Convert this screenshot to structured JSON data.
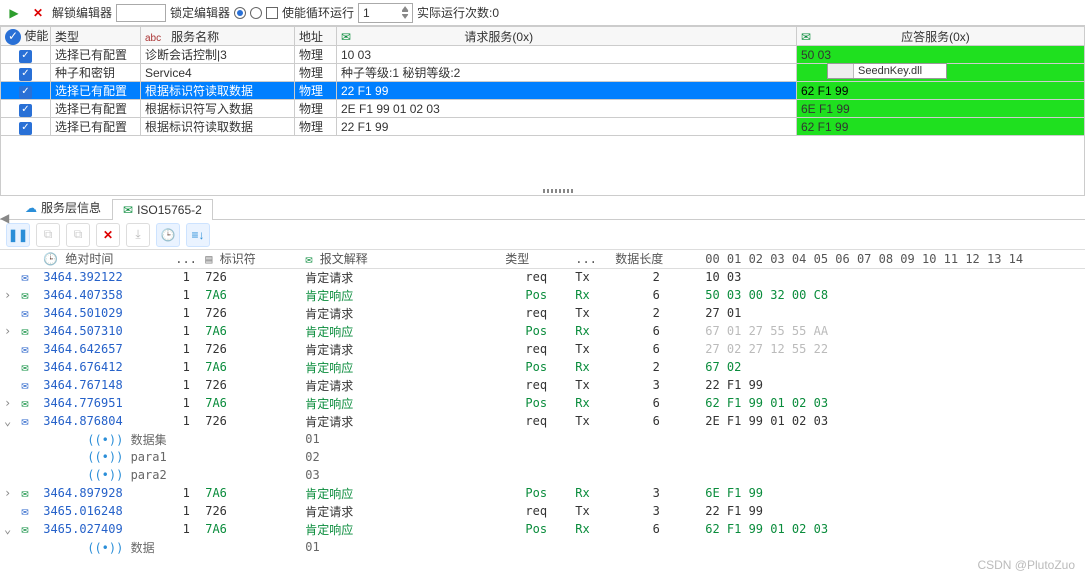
{
  "toolbar": {
    "unlock_label": "解锁编辑器",
    "lock_label": "锁定编辑器",
    "loop_label": "使能循环运行",
    "loop_count": "1",
    "actual_runs_label": "实际运行次数:0"
  },
  "grid": {
    "headers": {
      "enable": "使能",
      "type": "类型",
      "type_hint": "abc",
      "service": "服务名称",
      "addr": "地址",
      "req": "请求服务(0x)",
      "resp": "应答服务(0x)"
    },
    "rows": [
      {
        "en": true,
        "type": "选择已有配置",
        "svc": "诊断会话控制|3",
        "addr": "物理",
        "req": "10 03",
        "resp": "50 03",
        "green": true,
        "sel": false
      },
      {
        "en": true,
        "type": "种子和密钥",
        "svc": "Service4",
        "addr": "物理",
        "req": "种子等级:1 秘钥等级:2",
        "resp": "",
        "green": true,
        "sel": false,
        "seed": "SeednKey.dll"
      },
      {
        "en": true,
        "type": "选择已有配置",
        "svc": "根据标识符读取数据",
        "addr": "物理",
        "req": "22 F1 99",
        "resp": "62 F1 99",
        "green": true,
        "sel": true
      },
      {
        "en": true,
        "type": "选择已有配置",
        "svc": "根据标识符写入数据",
        "addr": "物理",
        "req": "2E F1 99 01 02 03",
        "resp": "6E F1 99",
        "green": true,
        "sel": false
      },
      {
        "en": true,
        "type": "选择已有配置",
        "svc": "根据标识符读取数据",
        "addr": "物理",
        "req": "22 F1 99",
        "resp": "62 F1 99",
        "green": true,
        "sel": false
      }
    ]
  },
  "tabs": {
    "svc_layer": "服务层信息",
    "iso": "ISO15765-2"
  },
  "log": {
    "headers": {
      "time": "绝对时间",
      "dots": "...",
      "id": "标识符",
      "msg": "报文解释",
      "kind": "类型",
      "dir": "...",
      "len": "数据长度"
    },
    "byte_headers": [
      "00",
      "01",
      "02",
      "03",
      "04",
      "05",
      "06",
      "07",
      "08",
      "09",
      "10",
      "11",
      "12",
      "13",
      "14"
    ],
    "rows": [
      {
        "t": "3464.392122",
        "n": "1",
        "id": "726",
        "msg": "肯定请求",
        "kind": "req",
        "dir": "Tx",
        "len": "2",
        "b": "10 03",
        "pos": false,
        "exp": ""
      },
      {
        "t": "3464.407358",
        "n": "1",
        "id": "7A6",
        "msg": "肯定响应",
        "kind": "Pos",
        "dir": "Rx",
        "len": "6",
        "b": "50 03 00 32 00 C8",
        "pos": true,
        "exp": ">"
      },
      {
        "t": "3464.501029",
        "n": "1",
        "id": "726",
        "msg": "肯定请求",
        "kind": "req",
        "dir": "Tx",
        "len": "2",
        "b": "27 01",
        "pos": false,
        "exp": ""
      },
      {
        "t": "3464.507310",
        "n": "1",
        "id": "7A6",
        "msg": "肯定响应",
        "kind": "Pos",
        "dir": "Rx",
        "len": "6",
        "b": "67 01 27 55 55 AA",
        "pos": true,
        "exp": ">",
        "dim": true
      },
      {
        "t": "3464.642657",
        "n": "1",
        "id": "726",
        "msg": "肯定请求",
        "kind": "req",
        "dir": "Tx",
        "len": "6",
        "b": "27 02 27 12 55 22",
        "pos": false,
        "exp": "",
        "dim": true
      },
      {
        "t": "3464.676412",
        "n": "1",
        "id": "7A6",
        "msg": "肯定响应",
        "kind": "Pos",
        "dir": "Rx",
        "len": "2",
        "b": "67 02",
        "pos": true,
        "exp": ""
      },
      {
        "t": "3464.767148",
        "n": "1",
        "id": "726",
        "msg": "肯定请求",
        "kind": "req",
        "dir": "Tx",
        "len": "3",
        "b": "22 F1 99",
        "pos": false,
        "exp": ""
      },
      {
        "t": "3464.776951",
        "n": "1",
        "id": "7A6",
        "msg": "肯定响应",
        "kind": "Pos",
        "dir": "Rx",
        "len": "6",
        "b": "62 F1 99 01 02 03",
        "pos": true,
        "exp": ">"
      },
      {
        "t": "3464.876804",
        "n": "1",
        "id": "726",
        "msg": "肯定请求",
        "kind": "req",
        "dir": "Tx",
        "len": "6",
        "b": "2E F1 99 01 02 03",
        "pos": false,
        "exp": "v"
      },
      {
        "t": "3464.897928",
        "n": "1",
        "id": "7A6",
        "msg": "肯定响应",
        "kind": "Pos",
        "dir": "Rx",
        "len": "3",
        "b": "6E F1 99",
        "pos": true,
        "exp": ">"
      },
      {
        "t": "3465.016248",
        "n": "1",
        "id": "726",
        "msg": "肯定请求",
        "kind": "req",
        "dir": "Tx",
        "len": "3",
        "b": "22 F1 99",
        "pos": false,
        "exp": ""
      },
      {
        "t": "3465.027409",
        "n": "1",
        "id": "7A6",
        "msg": "肯定响应",
        "kind": "Pos",
        "dir": "Rx",
        "len": "6",
        "b": "62 F1 99 01 02 03",
        "pos": true,
        "exp": "v"
      }
    ],
    "sub_876": [
      {
        "label": "数据集",
        "val": "01"
      },
      {
        "label": "para1",
        "val": "02"
      },
      {
        "label": "para2",
        "val": "03"
      }
    ],
    "sub_027": {
      "label": "数据",
      "val": "01"
    }
  },
  "watermark": "CSDN @PlutoZuo"
}
